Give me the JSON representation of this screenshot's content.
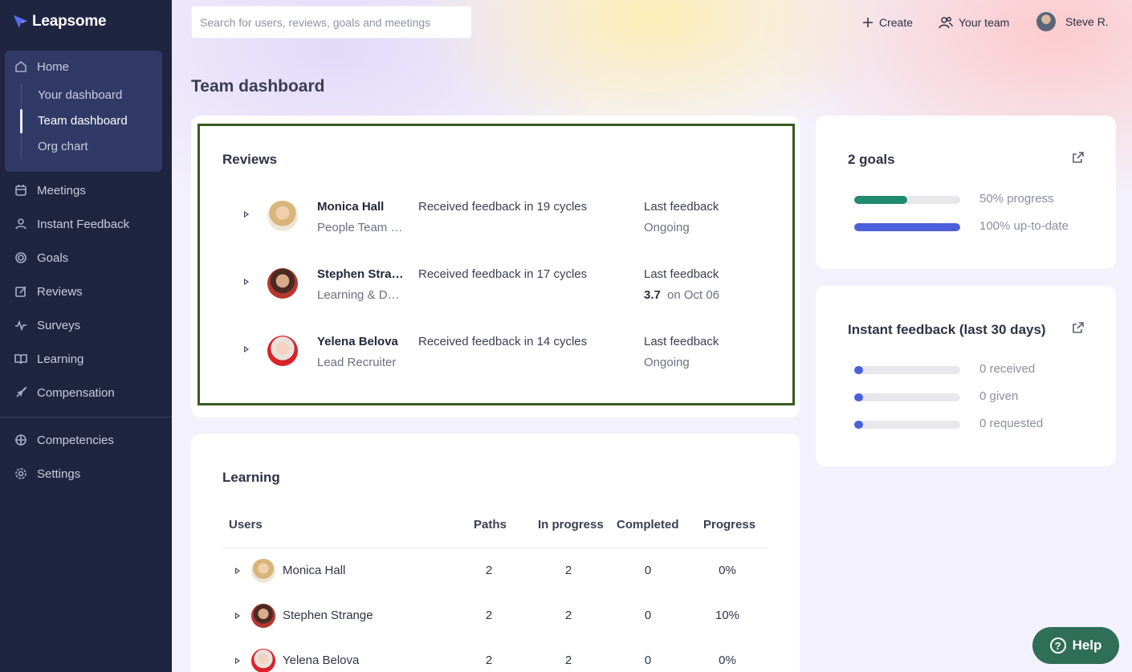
{
  "app": {
    "name": "Leapsome"
  },
  "sidebar": {
    "home": "Home",
    "sub_items": [
      "Your dashboard",
      "Team dashboard",
      "Org chart"
    ],
    "items": [
      "Meetings",
      "Instant Feedback",
      "Goals",
      "Reviews",
      "Surveys",
      "Learning",
      "Compensation"
    ],
    "bottom_items": [
      "Competencies",
      "Settings"
    ]
  },
  "header": {
    "search_placeholder": "Search for users, reviews, goals and meetings",
    "create": "Create",
    "your_team": "Your team",
    "user": "Steve R."
  },
  "page_title": "Team dashboard",
  "reviews": {
    "title": "Reviews",
    "rows": [
      {
        "name": "Monica Hall",
        "role": "People Team Lead",
        "text": "Received feedback in 19 cycles",
        "last_label": "Last feedback",
        "last_value": "Ongoing",
        "score": ""
      },
      {
        "name": "Stephen Strange",
        "role": "Learning & Development",
        "text": "Received feedback in 17 cycles",
        "last_label": "Last feedback",
        "last_value": "on Oct 06",
        "score": "3.7"
      },
      {
        "name": "Yelena Belova",
        "role": "Lead Recruiter",
        "text": "Received feedback in 14 cycles",
        "last_label": "Last feedback",
        "last_value": "Ongoing",
        "score": ""
      }
    ]
  },
  "goals": {
    "title": "2 goals",
    "bars": [
      {
        "label": "50% progress",
        "value": 0.5,
        "color": "#1f8a70"
      },
      {
        "label": "100% up-to-date",
        "value": 1.0,
        "color": "#4a5fd9"
      }
    ]
  },
  "instant_feedback": {
    "title": "Instant feedback (last 30 days)",
    "bars": [
      {
        "label": "0 received",
        "value": 0,
        "color": "#4a5fd9"
      },
      {
        "label": "0 given",
        "value": 0,
        "color": "#4a5fd9"
      },
      {
        "label": "0 requested",
        "value": 0,
        "color": "#4a5fd9"
      }
    ]
  },
  "learning": {
    "title": "Learning",
    "columns": [
      "Users",
      "Paths",
      "In progress",
      "Completed",
      "Progress"
    ],
    "rows": [
      {
        "name": "Monica Hall",
        "paths": "2",
        "in_progress": "2",
        "completed": "0",
        "progress": "0%"
      },
      {
        "name": "Stephen Strange",
        "paths": "2",
        "in_progress": "2",
        "completed": "0",
        "progress": "10%"
      },
      {
        "name": "Yelena Belova",
        "paths": "2",
        "in_progress": "2",
        "completed": "0",
        "progress": "0%"
      }
    ]
  },
  "help": "Help"
}
